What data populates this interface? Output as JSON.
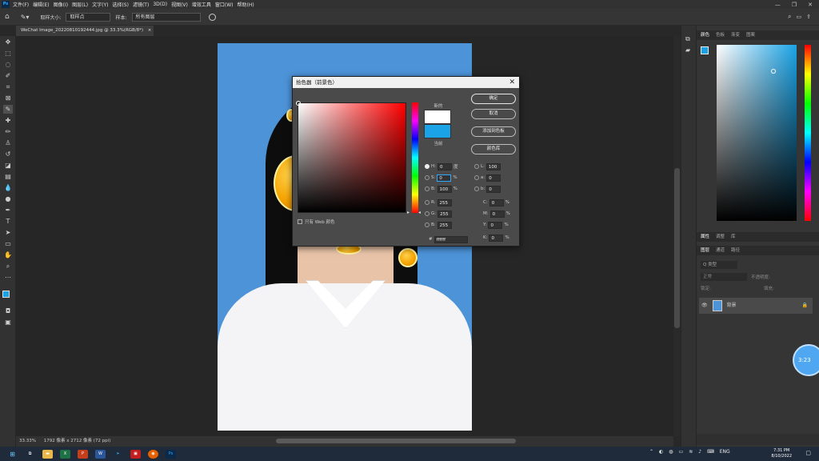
{
  "menubar": {
    "logo": "Ps",
    "items": [
      "文件(F)",
      "编辑(E)",
      "图像(I)",
      "图层(L)",
      "文字(Y)",
      "选择(S)",
      "滤镜(T)",
      "3D(D)",
      "视图(V)",
      "增效工具",
      "窗口(W)",
      "帮助(H)"
    ],
    "win_min": "—",
    "win_max": "❐",
    "win_close": "✕"
  },
  "options": {
    "sample_size_label": "取样大小:",
    "sample_size_value": "取样点",
    "sample_label": "样本:",
    "sample_value": "所有图层"
  },
  "document": {
    "tab_label": "WeChat Image_20220810192444.jpg @ 33.3%(RGB/8*)",
    "tab_close": "×",
    "zoom": "33.33%",
    "size_info": "1792 像素 x 2712 像素 (72 ppi)"
  },
  "color_picker": {
    "title": "拾色器（前景色）",
    "close": "✕",
    "new_label": "新的",
    "current_label": "当前",
    "buttons": [
      "确定",
      "取消",
      "添加到色板",
      "颜色库"
    ],
    "web_only_label": "只有 Web 颜色",
    "fields": {
      "H": "0",
      "S": "0",
      "B": "100",
      "R": "255",
      "G": "255",
      "Bb": "255",
      "L": "100",
      "a": "0",
      "b": "0",
      "C": "0",
      "M": "0",
      "Y": "0",
      "K": "0"
    },
    "h_unit": "度",
    "pct": "%",
    "hex_label": "#",
    "hex": "ffffff",
    "new_color": "#ffffff",
    "current_color": "#1aa3e6"
  },
  "right_panel": {
    "color_tabs": [
      "颜色",
      "色板",
      "渐变",
      "图案"
    ],
    "props_tabs": [
      "属性",
      "调整",
      "库"
    ],
    "layers_tabs": [
      "图层",
      "通道",
      "路径"
    ],
    "kind_label": "Q 类型",
    "blend_mode": "正常",
    "opacity_label": "不透明度:",
    "lock_label": "锁定:",
    "fill_label": "填充:",
    "layer_name": "背景"
  },
  "overlay_badge": "3:23",
  "taskbar": {
    "time": "7:31 PM",
    "date": "8/10/2022",
    "lang": "ENG"
  }
}
